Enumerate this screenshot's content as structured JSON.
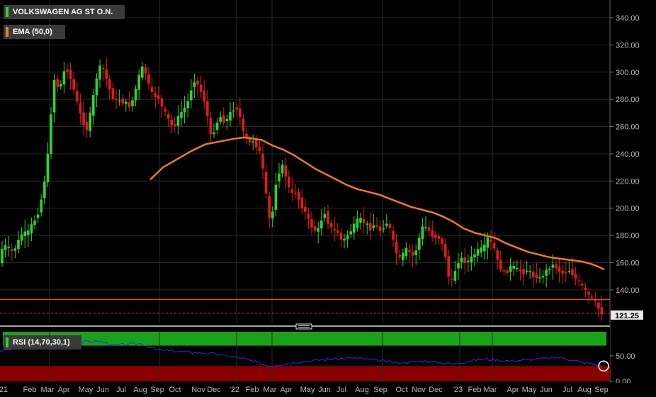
{
  "chart_data": [
    {
      "type": "candlestick",
      "series": [
        {
          "name": "VOLKSWAGEN AG ST O.N.",
          "color": "#2bd62b",
          "down_color": "#e31a1a"
        },
        {
          "name": "EMA (50,0)",
          "color": "#f07a1a"
        }
      ],
      "x_tick_labels": [
        "21",
        "Feb",
        "Mar",
        "Apr",
        "May",
        "Jun",
        "Jul",
        "Aug",
        "Sep",
        "Oct",
        "Nov",
        "Dec",
        "'22",
        "Feb",
        "Mar",
        "Apr",
        "May",
        "Jun",
        "Jul",
        "Aug",
        "Sep",
        "Oct",
        "Nov",
        "Dec",
        "'23",
        "Feb",
        "Mar",
        "Apr",
        "May",
        "Jun",
        "Jul",
        "Aug",
        "Sep"
      ],
      "y_tick_labels": [
        "340.00",
        "320.00",
        "300.00",
        "280.00",
        "260.00",
        "240.00",
        "220.00",
        "200.00",
        "180.00",
        "160.00",
        "140.00"
      ],
      "ylim": [
        116,
        353
      ],
      "last_price": "121.25",
      "last_price_color": "#ff2222",
      "support_level": 133,
      "support_color": "#e34a2a",
      "price_path": [
        [
          0,
          158
        ],
        [
          5,
          170
        ],
        [
          10,
          172
        ],
        [
          15,
          170
        ],
        [
          20,
          168
        ],
        [
          25,
          172
        ],
        [
          30,
          178
        ],
        [
          35,
          183
        ],
        [
          40,
          180
        ],
        [
          45,
          186
        ],
        [
          50,
          190
        ],
        [
          55,
          195
        ],
        [
          60,
          205
        ],
        [
          65,
          220
        ],
        [
          70,
          240
        ],
        [
          75,
          275
        ],
        [
          80,
          300
        ],
        [
          85,
          285
        ],
        [
          90,
          295
        ],
        [
          95,
          305
        ],
        [
          100,
          298
        ],
        [
          105,
          290
        ],
        [
          110,
          280
        ],
        [
          115,
          270
        ],
        [
          120,
          263
        ],
        [
          125,
          258
        ],
        [
          130,
          270
        ],
        [
          135,
          285
        ],
        [
          140,
          300
        ],
        [
          145,
          305
        ],
        [
          150,
          300
        ],
        [
          155,
          290
        ],
        [
          160,
          283
        ],
        [
          165,
          278
        ],
        [
          170,
          280
        ],
        [
          175,
          278
        ],
        [
          180,
          277
        ],
        [
          185,
          275
        ],
        [
          190,
          280
        ],
        [
          195,
          290
        ],
        [
          200,
          300
        ],
        [
          205,
          305
        ],
        [
          210,
          295
        ],
        [
          215,
          285
        ],
        [
          220,
          282
        ],
        [
          225,
          283
        ],
        [
          230,
          275
        ],
        [
          235,
          270
        ],
        [
          240,
          265
        ],
        [
          245,
          260
        ],
        [
          250,
          262
        ],
        [
          255,
          268
        ],
        [
          260,
          272
        ],
        [
          265,
          275
        ],
        [
          270,
          282
        ],
        [
          275,
          295
        ],
        [
          280,
          292
        ],
        [
          285,
          287
        ],
        [
          290,
          280
        ],
        [
          295,
          268
        ],
        [
          300,
          252
        ],
        [
          305,
          258
        ],
        [
          310,
          265
        ],
        [
          315,
          268
        ],
        [
          320,
          262
        ],
        [
          325,
          268
        ],
        [
          330,
          272
        ],
        [
          335,
          275
        ],
        [
          340,
          270
        ],
        [
          345,
          256
        ],
        [
          350,
          252
        ],
        [
          355,
          248
        ],
        [
          360,
          250
        ],
        [
          365,
          245
        ],
        [
          370,
          240
        ],
        [
          375,
          222
        ],
        [
          380,
          200
        ],
        [
          385,
          185
        ],
        [
          390,
          215
        ],
        [
          395,
          225
        ],
        [
          400,
          232
        ],
        [
          405,
          225
        ],
        [
          410,
          215
        ],
        [
          415,
          210
        ],
        [
          420,
          212
        ],
        [
          425,
          205
        ],
        [
          430,
          200
        ],
        [
          435,
          195
        ],
        [
          440,
          188
        ],
        [
          445,
          185
        ],
        [
          450,
          182
        ],
        [
          455,
          190
        ],
        [
          460,
          198
        ],
        [
          465,
          190
        ],
        [
          470,
          185
        ],
        [
          475,
          183
        ],
        [
          480,
          182
        ],
        [
          485,
          175
        ],
        [
          490,
          178
        ],
        [
          495,
          182
        ],
        [
          500,
          185
        ],
        [
          505,
          190
        ],
        [
          510,
          192
        ],
        [
          515,
          190
        ],
        [
          520,
          188
        ],
        [
          525,
          185
        ],
        [
          530,
          188
        ],
        [
          535,
          186
        ],
        [
          540,
          183
        ],
        [
          545,
          188
        ],
        [
          550,
          190
        ],
        [
          555,
          180
        ],
        [
          560,
          170
        ],
        [
          565,
          162
        ],
        [
          570,
          165
        ],
        [
          575,
          170
        ],
        [
          580,
          168
        ],
        [
          585,
          165
        ],
        [
          590,
          170
        ],
        [
          595,
          180
        ],
        [
          600,
          188
        ],
        [
          605,
          185
        ],
        [
          610,
          182
        ],
        [
          615,
          178
        ],
        [
          620,
          180
        ],
        [
          625,
          175
        ],
        [
          630,
          168
        ],
        [
          635,
          150
        ],
        [
          640,
          146
        ],
        [
          645,
          155
        ],
        [
          650,
          162
        ],
        [
          655,
          163
        ],
        [
          660,
          160
        ],
        [
          665,
          162
        ],
        [
          670,
          165
        ],
        [
          675,
          168
        ],
        [
          680,
          170
        ],
        [
          685,
          170
        ],
        [
          690,
          178
        ],
        [
          695,
          175
        ],
        [
          700,
          170
        ],
        [
          705,
          160
        ],
        [
          710,
          155
        ],
        [
          715,
          152
        ],
        [
          720,
          155
        ],
        [
          725,
          158
        ],
        [
          730,
          155
        ],
        [
          735,
          155
        ],
        [
          740,
          152
        ],
        [
          745,
          155
        ],
        [
          750,
          153
        ],
        [
          755,
          150
        ],
        [
          760,
          150
        ],
        [
          765,
          148
        ],
        [
          770,
          152
        ],
        [
          775,
          155
        ],
        [
          780,
          158
        ],
        [
          785,
          158
        ],
        [
          790,
          155
        ],
        [
          795,
          152
        ],
        [
          800,
          153
        ],
        [
          805,
          155
        ],
        [
          810,
          152
        ],
        [
          815,
          148
        ],
        [
          820,
          145
        ],
        [
          825,
          142
        ],
        [
          830,
          138
        ],
        [
          835,
          135
        ],
        [
          840,
          133
        ],
        [
          845,
          128
        ],
        [
          850,
          124
        ],
        [
          855,
          121.25
        ]
      ],
      "ema_path": [
        [
          212,
          221
        ],
        [
          230,
          230
        ],
        [
          250,
          236
        ],
        [
          270,
          242
        ],
        [
          290,
          247
        ],
        [
          310,
          249
        ],
        [
          330,
          251
        ],
        [
          345,
          252
        ],
        [
          360,
          251
        ],
        [
          370,
          250
        ],
        [
          385,
          246
        ],
        [
          400,
          243
        ],
        [
          415,
          239
        ],
        [
          430,
          234
        ],
        [
          445,
          229
        ],
        [
          460,
          225
        ],
        [
          475,
          221
        ],
        [
          490,
          217
        ],
        [
          505,
          214
        ],
        [
          520,
          212
        ],
        [
          535,
          210
        ],
        [
          550,
          207
        ],
        [
          565,
          204
        ],
        [
          580,
          201
        ],
        [
          595,
          199
        ],
        [
          610,
          197
        ],
        [
          625,
          194
        ],
        [
          640,
          190
        ],
        [
          655,
          185
        ],
        [
          670,
          182
        ],
        [
          685,
          180
        ],
        [
          700,
          178
        ],
        [
          715,
          174
        ],
        [
          730,
          171
        ],
        [
          745,
          168
        ],
        [
          760,
          166
        ],
        [
          775,
          164
        ],
        [
          790,
          163
        ],
        [
          805,
          162
        ],
        [
          820,
          161
        ],
        [
          835,
          159
        ],
        [
          845,
          157
        ],
        [
          853,
          155
        ]
      ]
    },
    {
      "type": "line",
      "series": [
        {
          "name": "RSI (14,70,30,1)",
          "color": "#2233ee"
        }
      ],
      "y_tick_labels": [
        "50.00",
        "0.00"
      ],
      "ylim": [
        -3,
        100
      ],
      "overbought_zone": [
        70,
        100
      ],
      "oversold_zone": [
        0,
        30
      ],
      "zone_colors": [
        "#1aa11a",
        "#8a0000"
      ],
      "rsi_path": [
        [
          0,
          60
        ],
        [
          50,
          68
        ],
        [
          100,
          76
        ],
        [
          140,
          79
        ],
        [
          160,
          71
        ],
        [
          200,
          74
        ],
        [
          220,
          62
        ],
        [
          260,
          58
        ],
        [
          300,
          54
        ],
        [
          340,
          46
        ],
        [
          380,
          30
        ],
        [
          420,
          38
        ],
        [
          460,
          43
        ],
        [
          500,
          46
        ],
        [
          540,
          40
        ],
        [
          560,
          36
        ],
        [
          600,
          40
        ],
        [
          640,
          34
        ],
        [
          680,
          44
        ],
        [
          720,
          40
        ],
        [
          760,
          44
        ],
        [
          790,
          47
        ],
        [
          820,
          38
        ],
        [
          850,
          30
        ]
      ]
    }
  ]
}
